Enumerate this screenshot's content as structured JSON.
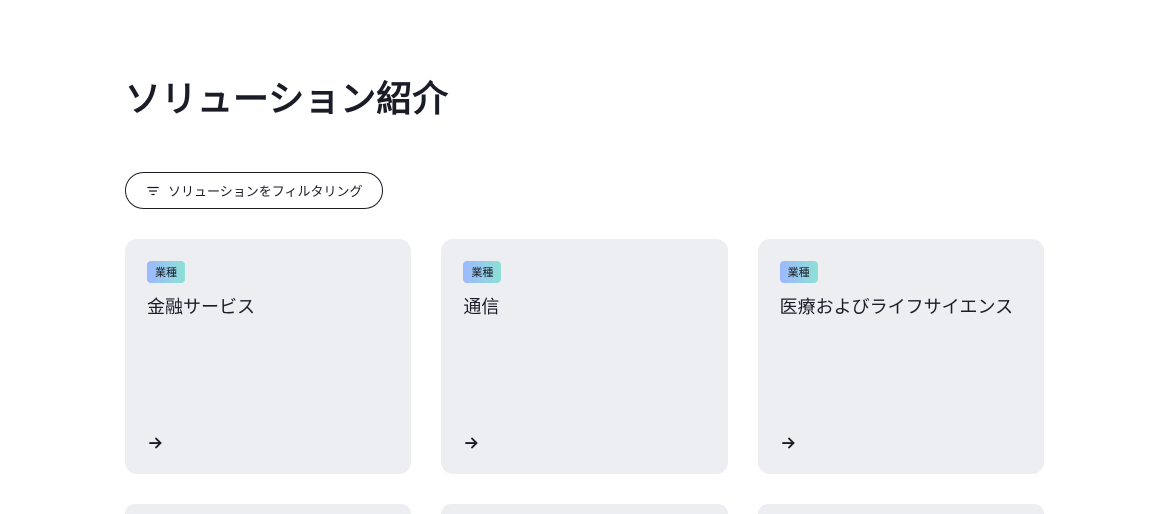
{
  "page": {
    "title": "ソリューション紹介"
  },
  "filter": {
    "label": "ソリューションをフィルタリング"
  },
  "badge": {
    "label": "業種"
  },
  "cards": [
    {
      "title": "金融サービス"
    },
    {
      "title": "通信"
    },
    {
      "title": "医療およびライフサイエンス"
    }
  ]
}
